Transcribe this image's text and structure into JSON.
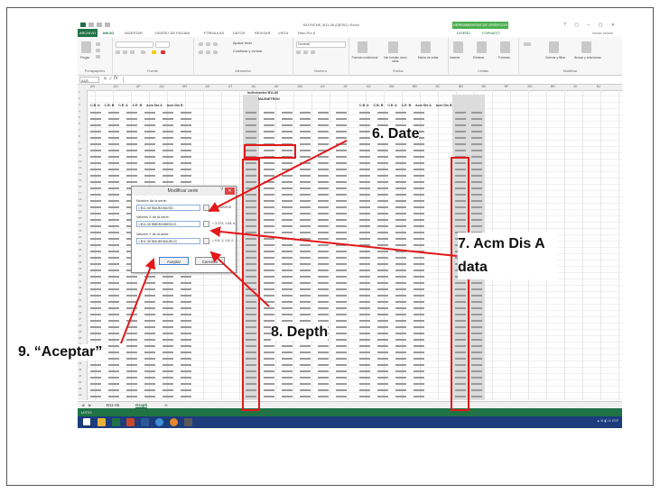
{
  "excel": {
    "window_title": "B11RICHE_B11-06 (0)ESD). Excel",
    "contextual_tab_group": "HERRAMIENTAS DE GRÁFICOS",
    "ribbon_tabs": [
      "ARCHIVO",
      "INICIO",
      "INSERTAR",
      "DISEÑO DE PÁGINA",
      "FÓRMULAS",
      "DATOS",
      "REVISAR",
      "VISTA",
      "Nitro Pro 8",
      "DISEÑO",
      "FORMATO"
    ],
    "ribbon_groups": [
      "Portapapeles",
      "Fuente",
      "Alineación",
      "Número",
      "Estilos",
      "Celdas",
      "Modificar"
    ],
    "ribbon_buttons": {
      "paste": "Pegar",
      "wrap_text": "Ajustar texto",
      "merge_center": "Combinar y centrar",
      "number_format": "General",
      "conditional_format": "Formato condicional",
      "format_as_table": "Dar formato como tabla",
      "cell_styles": "Estilos de celda",
      "insert": "Insertar",
      "delete": "Eliminar",
      "format": "Formato",
      "sort_filter": "Ordenar y filtrar",
      "find_select": "Buscar y seleccionar",
      "sign_in": "Iniciar sesión"
    },
    "name_box": "AU5",
    "formula_fx": "fx",
    "columns": [
      "AN",
      "AO",
      "AP",
      "AQ",
      "AR",
      "AS",
      "AT",
      "AU",
      "AV",
      "AW",
      "AX",
      "AY",
      "AZ",
      "BA",
      "BB",
      "BC",
      "BD",
      "BE",
      "BF",
      "BG",
      "BH",
      "BI",
      "BJ"
    ],
    "table_title": "Inclinómetro B11-06",
    "table_subtitle": "MAGNETRON",
    "left_headers": [
      "C.B. A",
      "C.B. B",
      "C.E. A",
      "C.E. B",
      "Acm Dis A",
      "Acm Dis B"
    ],
    "right_headers": [
      "C.B. A",
      "C.B. B",
      "C.E. A",
      "C.E. B",
      "Acm Dis A",
      "Acm Dis B"
    ],
    "sheet_tabs": [
      "B11-06",
      "Graph"
    ],
    "status": "LISTO"
  },
  "dialog": {
    "title": "Modificar serie",
    "help": "?",
    "close": "✕",
    "series_name_label": "Nombre de la serie:",
    "series_name_value": "='B11-06'!$AU$3:$AX$3",
    "series_name_result": "= 19/06/2015",
    "x_values_label": "Valores X de la serie:",
    "x_values_value": "='B11-06'!$BE$5:$BE$123",
    "x_values_result": "= 3.373; 1.05; 6...",
    "y_values_label": "Valores Y de la serie:",
    "y_values_value": "='B11-06'!$AU$5:$AU$123",
    "y_values_result": "= 0.5; 1; 1.5; 2...",
    "ok_button": "Aceptar",
    "cancel_button": "Cancelar"
  },
  "callouts": {
    "date": "6. Date",
    "acm": "7. Acm Dis A data",
    "depth": "8. Depth",
    "accept": "9. “Aceptar”"
  },
  "colors": {
    "excel_green": "#217346",
    "callout_red": "#e3181a",
    "taskbar": "#1c3c7c"
  }
}
